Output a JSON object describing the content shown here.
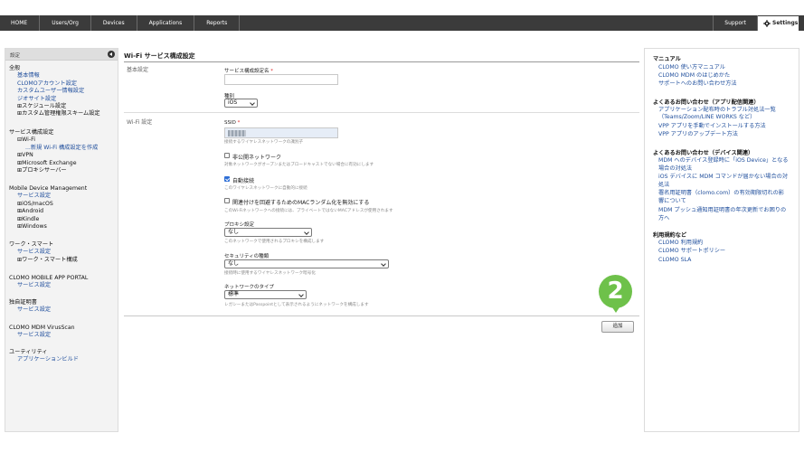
{
  "topnav": {
    "items": [
      {
        "label": "HOME"
      },
      {
        "label": "Users/Org"
      },
      {
        "label": "Devices"
      },
      {
        "label": "Applications"
      },
      {
        "label": "Reports"
      }
    ],
    "support_label": "Support",
    "settings_label": "Settings"
  },
  "sidebar": {
    "header": "設定",
    "groups": [
      {
        "title": "全般",
        "items": [
          "基本情報",
          "CLOMOアカウント設定",
          "カスタムユーザー情報設定",
          "ジオサイト設定",
          "⊞スケジュール設定",
          "⊞カスタム管理権限スキーム設定"
        ]
      },
      {
        "title": "サービス構成設定",
        "items": [
          "⊟Wi-Fi",
          "...新規 Wi-Fi 構成設定を作成",
          "⊞VPN",
          "⊞Microsoft Exchange",
          "⊞プロキシサーバー"
        ]
      },
      {
        "title": "Mobile Device Management",
        "items": [
          "サービス設定",
          "⊞iOS/macOS",
          "⊞Android",
          "⊞Kindle",
          "⊞Windows"
        ]
      },
      {
        "title": "ワーク・スマート",
        "items": [
          "サービス設定",
          "⊞ワーク・スマート構成"
        ]
      },
      {
        "title": "CLOMO MOBILE APP PORTAL",
        "items": [
          "サービス設定"
        ]
      },
      {
        "title": "独自証明書",
        "items": [
          "サービス設定"
        ]
      },
      {
        "title": "CLOMO MDM VirusScan",
        "items": [
          "サービス設定"
        ]
      },
      {
        "title": "ユーティリティ",
        "items": [
          "アプリケーションビルド"
        ]
      }
    ]
  },
  "main": {
    "title": "Wi-Fi サービス構成設定",
    "basic_section": "基本設定",
    "wifi_section": "Wi-Fi 設定",
    "name_label": "サービス構成設定名",
    "required_mark": "*",
    "type_label": "種別",
    "type_value": "iOS",
    "ssid_label": "SSID",
    "ssid_hint": "接続するワイヤレスネットワークの識別子",
    "hidden_label": "非公開ネットワーク",
    "hidden_hint": "対象ネットワークがオープンまたはブロードキャストでない場合に有効にします",
    "hidden_checked": false,
    "autojoin_label": "自動接続",
    "autojoin_hint": "このワイヤレスネットワークに自動的に接続",
    "autojoin_checked": true,
    "mac_label": "関連付けを回避するためのMACランダム化を無効にする",
    "mac_hint": "このWi-Fiネットワークへの接続には、プライベートではないMACアドレスが使用されます",
    "mac_checked": false,
    "proxy_label": "プロキシ設定",
    "proxy_value": "なし",
    "proxy_hint": "このネットワークで使用されるプロキシを構成します",
    "security_label": "セキュリティの種類",
    "security_value": "なし",
    "security_hint": "接続時に使用するワイヤレスネットワーク暗号化",
    "nettype_label": "ネットワークのタイプ",
    "nettype_value": "標準",
    "nettype_hint": "レガシーまたはPasspointとして表示されるようにネットワークを構成します",
    "add_button": "追加",
    "step_marker": "2"
  },
  "rightpanel": {
    "manual_head": "マニュアル",
    "manual_links": [
      "CLOMO 使い方マニュアル",
      "CLOMO MDM のはじめかた",
      "サポートへのお問い合わせ方法"
    ],
    "faq_app_head": "よくあるお問い合わせ（アプリ配信関連）",
    "faq_app_links": [
      "アプリケーション配布時のトラブル対処法一覧",
      "（Teams/Zoom/LINE WORKS など）",
      "VPP アプリを手動でインストールする方法",
      "VPP アプリのアップデート方法"
    ],
    "faq_dev_head": "よくあるお問い合わせ（デバイス関連）",
    "faq_dev_links": [
      "MDM へのデバイス登録時に「iOS Device」となる",
      "場合の対処法",
      "iOS デバイスに MDM コマンドが届かない場合の対",
      "処法",
      "署名用証明書（clomo.com）の有効期限切れの影",
      "響について",
      "MDM プッシュ通知用証明書の年次更新でお困りの",
      "方へ"
    ],
    "terms_head": "利用規約など",
    "terms_links": [
      "CLOMO 利用規約",
      "CLOMO サポートポリシー",
      "CLOMO SLA"
    ]
  },
  "colors": {
    "topbar": "#3b3b3b",
    "link": "#1f4e9c",
    "marker": "#6ec14a",
    "required": "#dd2222"
  }
}
